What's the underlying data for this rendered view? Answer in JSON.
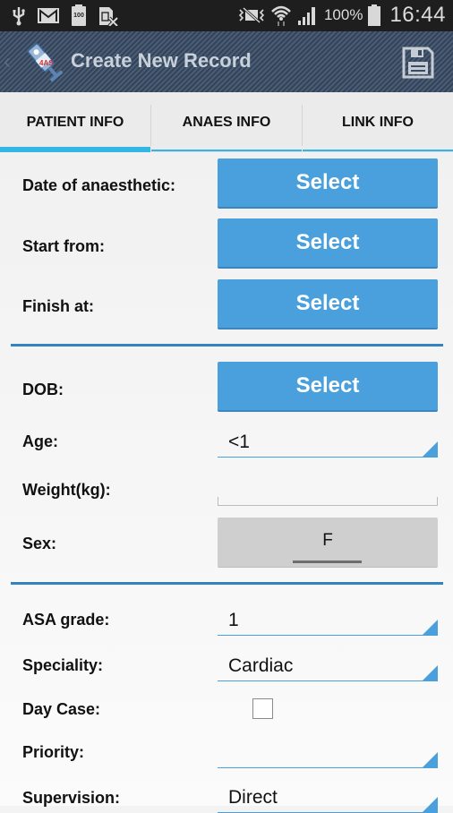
{
  "statusbar": {
    "left_icons": [
      "usb-icon",
      "gmail-icon",
      "battery-100-notification-icon",
      "sim-card-x-icon"
    ],
    "right_icons": [
      "vibrate-mute-icon",
      "wifi-icon",
      "signal-icon",
      "battery-icon"
    ],
    "battery_notification": "100",
    "battery_percent": "100%",
    "time": "16:44"
  },
  "actionbar": {
    "title": "Create New Record",
    "logo_text": "4AS",
    "save_icon": "save-icon"
  },
  "tabs": [
    {
      "label": "PATIENT INFO",
      "active": true
    },
    {
      "label": "ANAES INFO",
      "active": false
    },
    {
      "label": "LINK INFO",
      "active": false
    }
  ],
  "form": {
    "date_label": "Date of anaesthetic:",
    "date_button": "Select",
    "start_label": "Start from:",
    "start_button": "Select",
    "finish_label": "Finish at:",
    "finish_button": "Select",
    "dob_label": "DOB:",
    "dob_button": "Select",
    "age_label": "Age:",
    "age_value": "<1",
    "weight_label": "Weight(kg):",
    "weight_value": "",
    "sex_label": "Sex:",
    "sex_value": "F",
    "asa_label": "ASA grade:",
    "asa_value": "1",
    "speciality_label": "Speciality:",
    "speciality_value": "Cardiac",
    "daycase_label": "Day Case:",
    "daycase_checked": false,
    "priority_label": "Priority:",
    "priority_value": "",
    "supervision_label": "Supervision:",
    "supervision_value": "Direct"
  },
  "colors": {
    "accent": "#4aa0dc",
    "tab_indicator": "#33b5e5",
    "divider": "#3283bf",
    "actionbar": "#3a4c62"
  }
}
